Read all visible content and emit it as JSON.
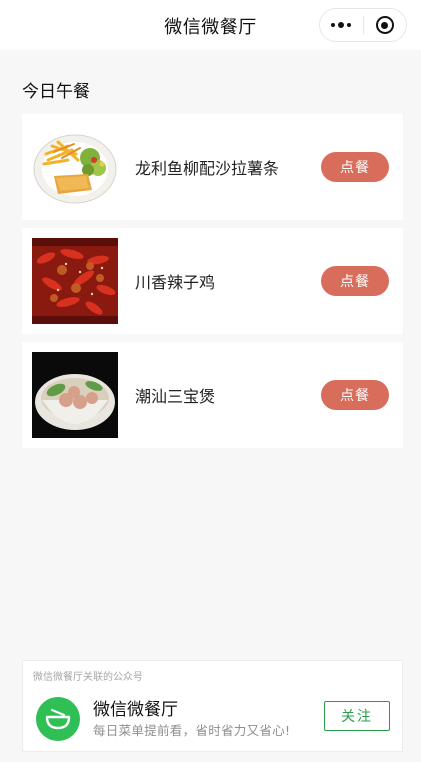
{
  "topbar": {
    "title": "微信微餐厅",
    "menu_icon": "more-dots-icon",
    "close_icon": "target-circle-icon"
  },
  "section": {
    "title": "今日午餐"
  },
  "dishes": [
    {
      "name": "龙利鱼柳配沙拉薯条",
      "button": "点餐",
      "image": "fish-fillet-salad-fries-photo"
    },
    {
      "name": "川香辣子鸡",
      "button": "点餐",
      "image": "spicy-chicken-photo"
    },
    {
      "name": "潮汕三宝煲",
      "button": "点餐",
      "image": "meatball-soup-pot-photo"
    }
  ],
  "official_account": {
    "caption": "微信微餐厅关联的公众号",
    "name": "微信微餐厅",
    "description": "每日菜单提前看，省时省力又省心!",
    "follow_label": "关注",
    "logo_icon": "bowl-icon"
  },
  "colors": {
    "order_button": "#d96d5b",
    "follow_green": "#2a9d4b",
    "logo_green": "#2fbf55",
    "background": "#f7f7f7"
  }
}
